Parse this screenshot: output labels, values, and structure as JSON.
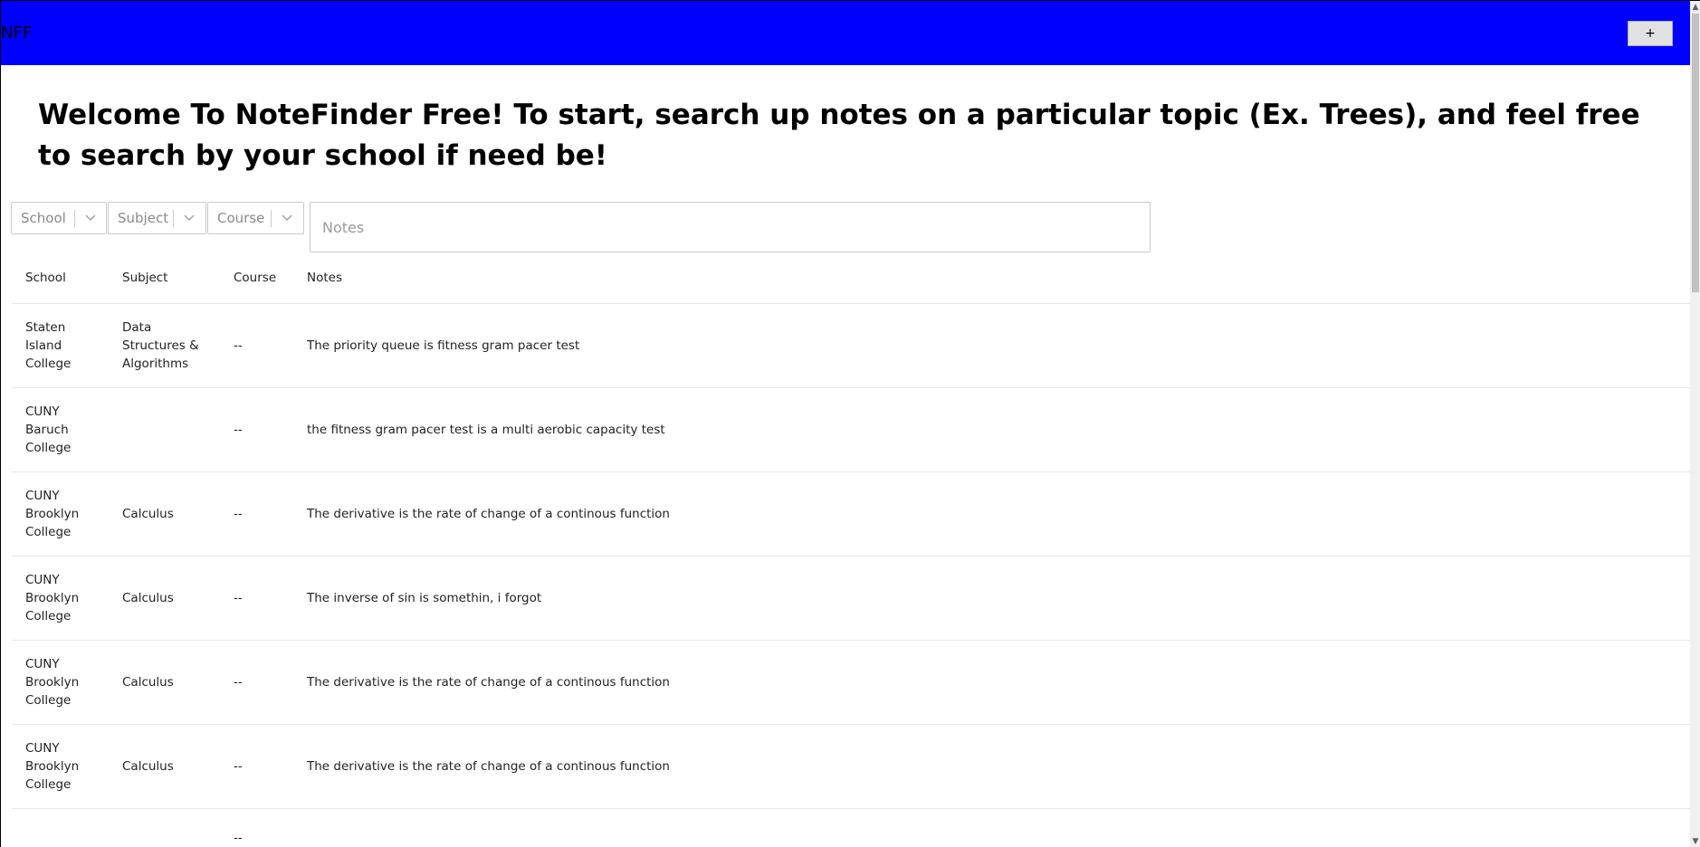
{
  "app": {
    "brand": "NFF",
    "add_button_label": "+"
  },
  "welcome": "Welcome To NoteFinder Free! To start, search up notes on a particular topic (Ex. Trees), and feel free to search by your school if need be!",
  "filters": {
    "school": "School",
    "subject": "Subject",
    "course": "Course",
    "notes_placeholder": "Notes",
    "notes_value": ""
  },
  "table": {
    "headers": {
      "school": "School",
      "subject": "Subject",
      "course": "Course",
      "notes": "Notes"
    },
    "rows": [
      {
        "school": "Staten Island College",
        "subject": "Data Structures & Algorithms",
        "course": "--",
        "notes": "The priority queue is fitness gram pacer test"
      },
      {
        "school": "CUNY Baruch College",
        "subject": "",
        "course": "--",
        "notes": "the fitness gram pacer test is a multi aerobic capacity test"
      },
      {
        "school": "CUNY Brooklyn College",
        "subject": "Calculus",
        "course": "--",
        "notes": "The derivative is the rate of change of a continous function"
      },
      {
        "school": "CUNY Brooklyn College",
        "subject": "Calculus",
        "course": "--",
        "notes": "The inverse of sin is somethin, i forgot"
      },
      {
        "school": "CUNY Brooklyn College",
        "subject": "Calculus",
        "course": "--",
        "notes": "The derivative is the rate of change of a continous function"
      },
      {
        "school": "CUNY Brooklyn College",
        "subject": "Calculus",
        "course": "--",
        "notes": "The derivative is the rate of change of a continous function"
      },
      {
        "school": "",
        "subject": "",
        "course": "--",
        "notes": ""
      }
    ]
  },
  "icons": {
    "chevron": "chevron-down-icon",
    "scroll_up": "scroll-up-arrow-icon",
    "scroll_down": "scroll-down-arrow-icon"
  },
  "colors": {
    "topbar": "#0000ff"
  }
}
